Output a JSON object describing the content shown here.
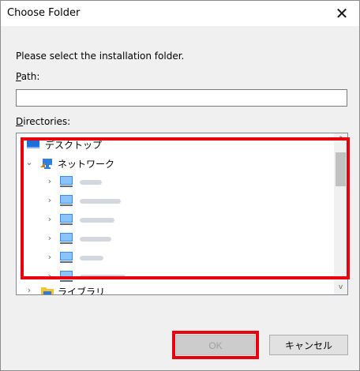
{
  "dialog": {
    "title": "Choose Folder",
    "close_symbol": "✕",
    "prompt": "Please select the installation folder.",
    "path_label": "Path:",
    "path_value": "",
    "directories_label": "Directories:"
  },
  "tree": {
    "items": [
      {
        "label": "デスクトップ",
        "level": 0,
        "expanded": false,
        "icon": "desktop-icon"
      },
      {
        "label": "ネットワーク",
        "level": 0,
        "expanded": true,
        "icon": "network-icon"
      },
      {
        "label": "",
        "level": 1,
        "icon": "computer-icon",
        "obscured": true
      },
      {
        "label": "",
        "level": 1,
        "icon": "computer-icon",
        "obscured": true
      },
      {
        "label": "",
        "level": 1,
        "icon": "computer-icon",
        "obscured": true
      },
      {
        "label": "",
        "level": 1,
        "icon": "computer-icon",
        "obscured": true
      },
      {
        "label": "",
        "level": 1,
        "icon": "computer-icon",
        "obscured": true
      },
      {
        "label": "",
        "level": 1,
        "icon": "computer-icon",
        "obscured": true
      },
      {
        "label": "ライブラリ",
        "level": 0,
        "expanded": false,
        "icon": "library-folder-icon"
      }
    ]
  },
  "buttons": {
    "ok": "OK",
    "cancel": "キャンセル"
  },
  "colors": {
    "highlight": "#e8000d",
    "window_bg": "#f0f0f0"
  }
}
